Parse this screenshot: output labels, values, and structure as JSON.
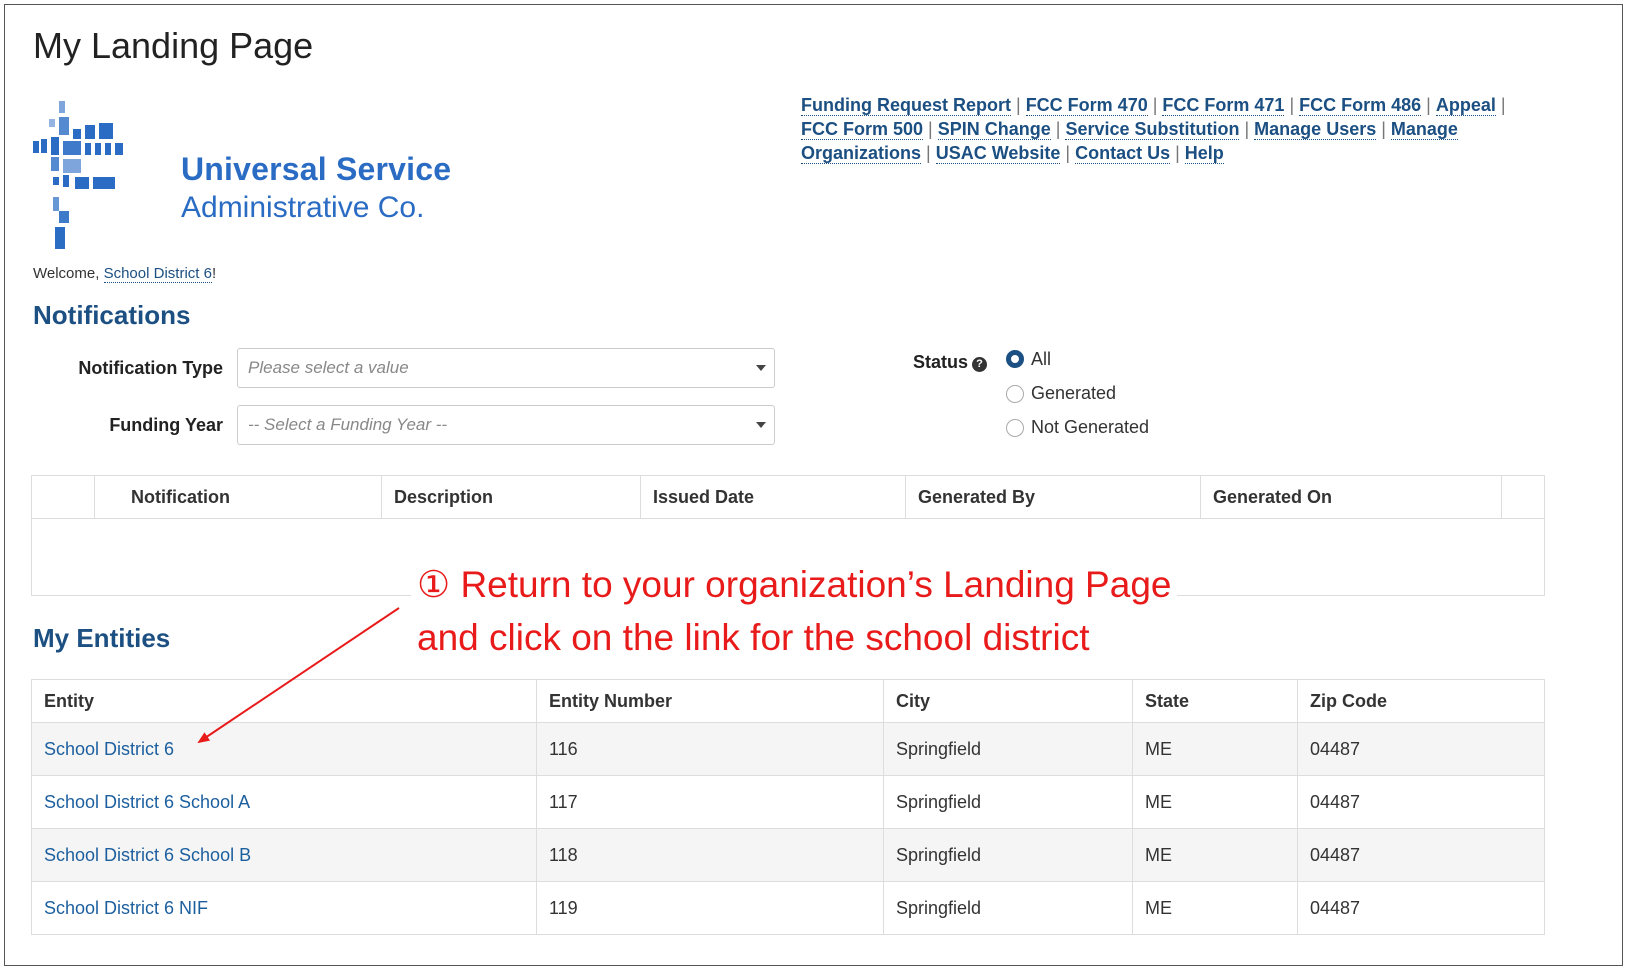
{
  "page": {
    "title": "My Landing Page"
  },
  "logo": {
    "line1": "Universal Service",
    "line2": "Administrative Co."
  },
  "nav_links": [
    "Funding Request Report",
    "FCC Form 470",
    "FCC Form 471",
    "FCC Form 486",
    "Appeal",
    "FCC Form 500",
    "SPIN Change",
    "Service Substitution",
    "Manage Users",
    "Manage Organizations",
    "USAC Website",
    "Contact Us",
    "Help"
  ],
  "welcome": {
    "prefix": "Welcome, ",
    "user": "School District 6",
    "suffix": "!"
  },
  "notifications": {
    "heading": "Notifications",
    "type_label": "Notification Type",
    "type_placeholder": "Please select a value",
    "year_label": "Funding Year",
    "year_placeholder": "-- Select a Funding Year --",
    "status_label": "Status",
    "status_options": [
      "All",
      "Generated",
      "Not Generated"
    ],
    "status_selected": "All",
    "columns": [
      "Notification",
      "Description",
      "Issued Date",
      "Generated By",
      "Generated On"
    ]
  },
  "entities": {
    "heading": "My Entities",
    "columns": [
      "Entity",
      "Entity Number",
      "City",
      "State",
      "Zip Code"
    ],
    "rows": [
      [
        "School District 6",
        "116",
        "Springfield",
        "ME",
        "04487"
      ],
      [
        "School District 6 School A",
        "117",
        "Springfield",
        "ME",
        "04487"
      ],
      [
        "School District 6 School B",
        "118",
        "Springfield",
        "ME",
        "04487"
      ],
      [
        "School District 6 NIF",
        "119",
        "Springfield",
        "ME",
        "04487"
      ]
    ]
  },
  "callout": {
    "line1": "① Return to your organization’s Landing Page",
    "line2": "and click on the link for the school district",
    "color": "#e81a1a"
  },
  "colors": {
    "brand": "#1c4f82",
    "logo": "#2a6bc4",
    "link": "#1c5f9e"
  }
}
